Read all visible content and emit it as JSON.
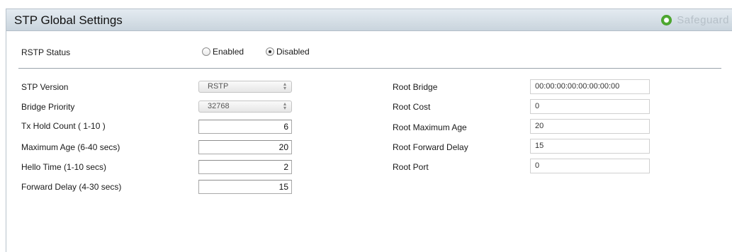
{
  "header": {
    "title": "STP Global Settings",
    "safeguard_label": "Safeguard"
  },
  "rstp": {
    "label": "RSTP Status",
    "options": [
      "Enabled",
      "Disabled"
    ],
    "selected": "Disabled"
  },
  "settings": {
    "stp_version": {
      "label": "STP Version",
      "value": "RSTP"
    },
    "bridge_priority": {
      "label": "Bridge Priority",
      "value": "32768"
    },
    "tx_hold_count": {
      "label": "Tx Hold Count  ( 1-10 )",
      "value": "6"
    },
    "max_age": {
      "label": "Maximum Age (6-40 secs)",
      "value": "20"
    },
    "hello_time": {
      "label": "Hello Time (1-10 secs)",
      "value": "2"
    },
    "forward_delay": {
      "label": "Forward Delay (4-30 secs)",
      "value": "15"
    }
  },
  "root": {
    "bridge": {
      "label": "Root Bridge",
      "value": "00:00:00:00:00:00:00:00"
    },
    "cost": {
      "label": "Root Cost",
      "value": "0"
    },
    "max_age": {
      "label": "Root Maximum Age",
      "value": "20"
    },
    "forward_delay": {
      "label": "Root Forward Delay",
      "value": "15"
    },
    "port": {
      "label": "Root Port",
      "value": "0"
    }
  }
}
